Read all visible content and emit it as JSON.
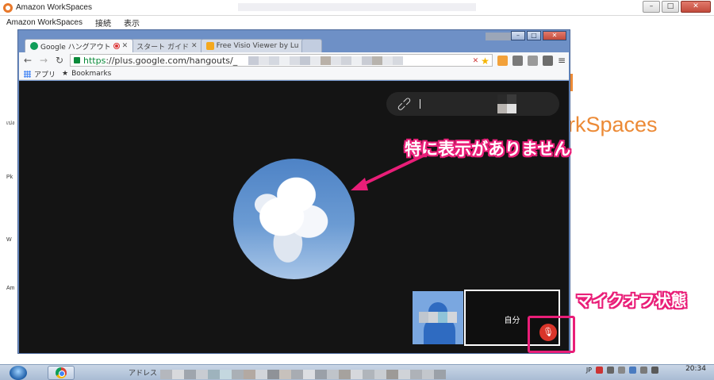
{
  "workspaces": {
    "title": "Amazon WorkSpaces",
    "menu": [
      "Amazon WorkSpaces",
      "接続",
      "表示"
    ],
    "brand_text": "rkSpaces",
    "desktop_labels": [
      "เปง",
      "Pk",
      "W",
      "Am"
    ]
  },
  "chrome": {
    "tabs": [
      {
        "label": "Google ハングアウト",
        "state": "active"
      },
      {
        "label": "スタート ガイド",
        "state": "inactive"
      },
      {
        "label": "Free Visio Viewer by Lu",
        "state": "inactive"
      }
    ],
    "url_scheme": "https",
    "url_rest": "://plus.google.com/hangouts/_",
    "bookmarks": [
      "アプリ",
      "Bookmarks"
    ]
  },
  "hangout": {
    "self_label": "自分",
    "annotation_no_display": "特に表示がありません",
    "annotation_mic_off": "マイクオフ状態"
  },
  "taskbar": {
    "address_label": "アドレス",
    "ime": "JP",
    "time": "20:34"
  },
  "colors": {
    "accent_pink": "#e91e78",
    "brand_orange": "#ec8a36",
    "mic_red": "#d8352a"
  }
}
